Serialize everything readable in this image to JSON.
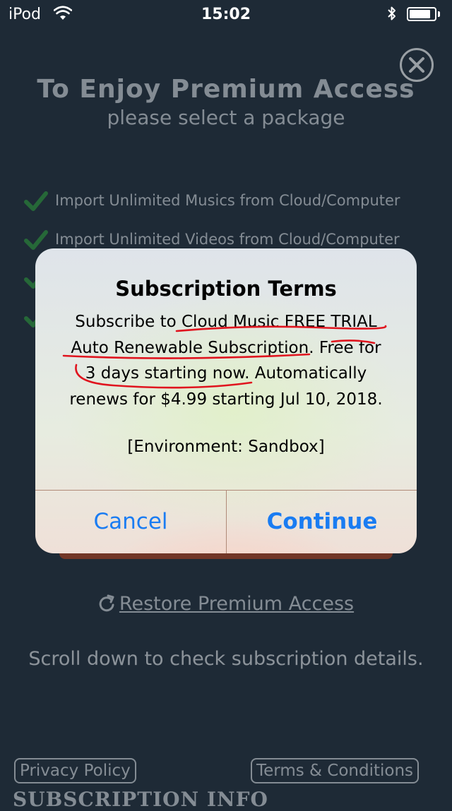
{
  "status_bar": {
    "carrier": "iPod",
    "time": "15:02",
    "battery_level": 0.85,
    "icons": [
      "wifi-icon",
      "bluetooth-icon",
      "battery-icon"
    ]
  },
  "background": {
    "title": "To Enjoy Premium Access",
    "subtitle": "please select a package",
    "features": [
      "Import Unlimited Musics from Cloud/Computer",
      "Import Unlimited Videos from Cloud/Computer",
      "",
      ""
    ],
    "restore_link": "Restore Premium Access",
    "scroll_hint": "Scroll down to check subscription details.",
    "privacy_policy": "Privacy Policy",
    "terms_conditions": "Terms & Conditions",
    "subscription_info": "SUBSCRIPTION INFO",
    "close_icon": "close-icon",
    "check_icon": "checkmark-icon",
    "accent_check": "#2e9b3a",
    "accent_buy": "#b8401c"
  },
  "alert": {
    "title": "Subscription Terms",
    "body_lines": [
      "Subscribe to Cloud Music FREE TRIAL",
      "Auto Renewable Subscription. Free for",
      "3 days starting now. Automatically",
      "renews for $4.99 starting Jul 10, 2018."
    ],
    "environment": "[Environment: Sandbox]",
    "cancel_label": "Cancel",
    "continue_label": "Continue",
    "button_color": "#1a7cf2",
    "annotation_color": "#e0141e"
  }
}
